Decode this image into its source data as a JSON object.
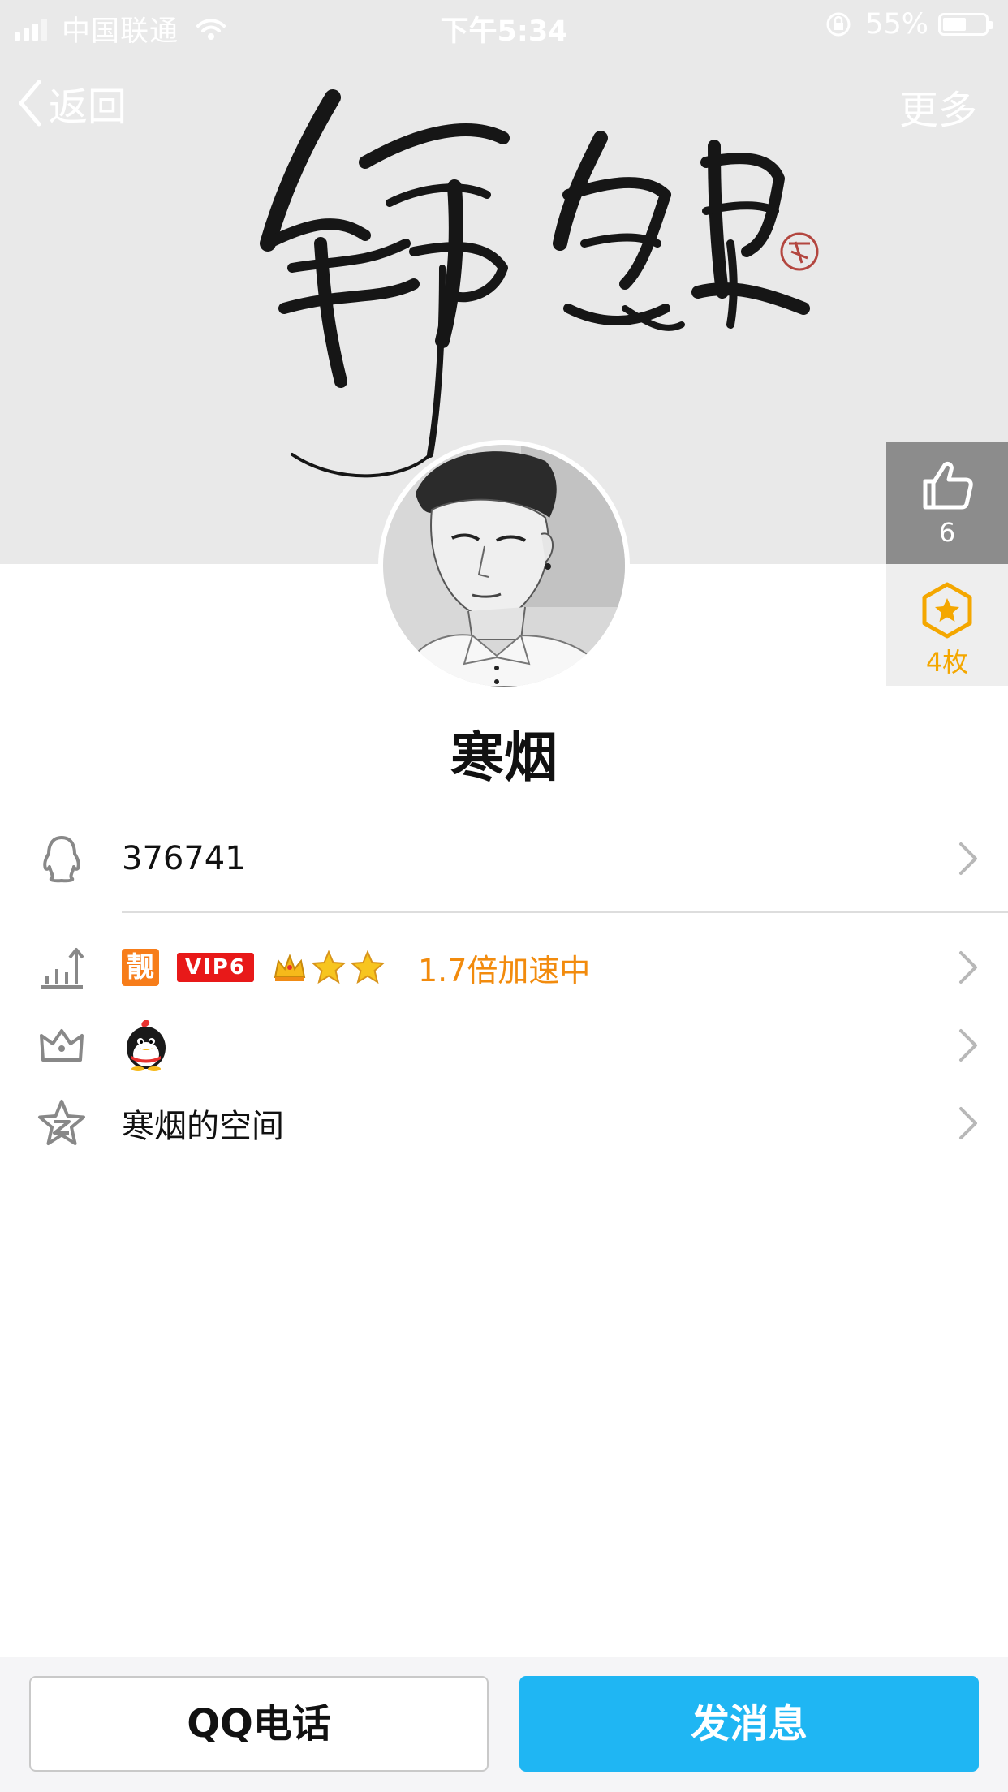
{
  "status_bar": {
    "carrier": "中国联通",
    "time": "下午5:34",
    "battery_text": "55%",
    "battery_level": 0.55
  },
  "nav": {
    "back_label": "返回",
    "more_label": "更多"
  },
  "cover": {
    "calligraphy_text": "錦鯉"
  },
  "profile": {
    "nickname": "寒烟",
    "likes": "6",
    "medals": "4枚"
  },
  "rows": {
    "qq_number": "376741",
    "level": {
      "liang_badge": "靓",
      "vip_badge": "VIP6",
      "speed_text": "1.7倍加速中"
    },
    "space_label": "寒烟的空间"
  },
  "buttons": {
    "call_label": "QQ电话",
    "message_label": "发消息"
  },
  "colors": {
    "accent_blue": "#1fb6f3",
    "orange": "#f28b0d",
    "vip_red": "#e81919",
    "medal_gold": "#f4a700"
  }
}
